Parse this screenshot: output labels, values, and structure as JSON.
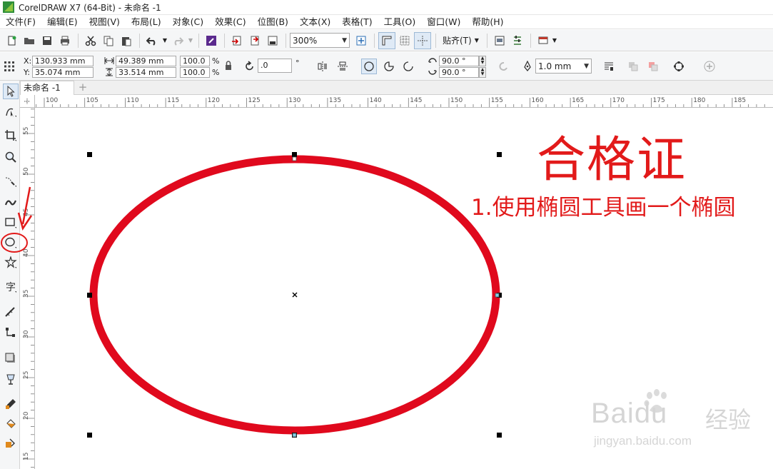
{
  "window": {
    "title": "CorelDRAW X7 (64-Bit) - 未命名 -1"
  },
  "menu": [
    "文件(F)",
    "编辑(E)",
    "视图(V)",
    "布局(L)",
    "对象(C)",
    "效果(C)",
    "位图(B)",
    "文本(X)",
    "表格(T)",
    "工具(O)",
    "窗口(W)",
    "帮助(H)"
  ],
  "toolbar": {
    "zoom_value": "300%",
    "snap_label": "贴齐(T)"
  },
  "propbar": {
    "x_label": "X:",
    "y_label": "Y:",
    "x_value": "130.933 mm",
    "y_value": "35.074 mm",
    "width_value": "49.389 mm",
    "height_value": "33.514 mm",
    "scale_w": "100.0",
    "scale_h": "100.0",
    "percent": "%",
    "rotation_value": ".0",
    "degree": "°",
    "start_angle": "90.0 °",
    "end_angle": "90.0 °",
    "outline_width": "1.0 mm"
  },
  "document": {
    "tab_label": "未命名 -1",
    "add_tab_symbol": "+"
  },
  "rulers": {
    "h_ticks": [
      100,
      105,
      110,
      115,
      120,
      125,
      130,
      135,
      140,
      145,
      150,
      155,
      160,
      165,
      170,
      175,
      180,
      185
    ],
    "v_ticks": [
      55,
      50,
      45,
      40,
      35,
      30,
      25,
      20,
      15
    ]
  },
  "annotation": {
    "title": "合格证",
    "subtitle": "1.使用椭圆工具画一个椭圆"
  },
  "colors": {
    "accent_red": "#e21a1a",
    "ellipse_outline": "#e0091d"
  },
  "watermark": {
    "brand": "Baidu",
    "jingyan": "经验",
    "url": "jingyan.baidu.com"
  }
}
